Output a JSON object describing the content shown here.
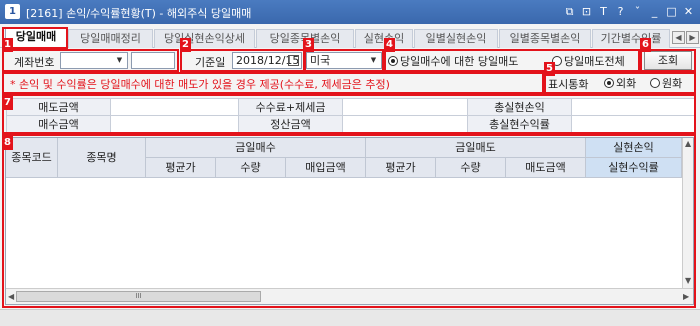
{
  "window": {
    "icon_text": "1",
    "title": "[2161] 손익/수익률현황(T) - 해외주식 당일매매",
    "buttons": [
      "⧉",
      "⊡",
      "T",
      "?",
      "ˇ",
      "_",
      "□",
      "✕"
    ]
  },
  "tabs": [
    "당일매매",
    "당일매매정리",
    "당일실현손익상세",
    "당일종목별손익",
    "실현손익",
    "일별실현손익",
    "일별종목별손익",
    "기간별수익률"
  ],
  "tab_nav": [
    "◀",
    "▶"
  ],
  "sections": [
    "1",
    "2",
    "3",
    "4",
    "5",
    "6",
    "7",
    "8"
  ],
  "form": {
    "account_label": "계좌번호",
    "account_value": "",
    "account_sub_value": "",
    "base_date_label": "기준일",
    "base_date_value": "2018/12/15",
    "market_value": "미국",
    "radio_today_buy": "당일매수에 대한 당일매도",
    "radio_all_sell": "당일매도전체",
    "query_button": "조회",
    "currency_label": "표시통화",
    "currency_foreign": "외화",
    "currency_won": "원화"
  },
  "notice": "* 손익 및 수익률은 당일매수에 대한 매도가 있을 경우 제공(수수료, 제세금은 추정)",
  "summary": {
    "sell_amount": "매도금액",
    "fee_tax": "수수료+제세금",
    "total_realized_pnl": "총실현손익",
    "buy_amount": "매수금액",
    "settle_amount": "정산금액",
    "total_realized_rate": "총실현수익률"
  },
  "grid": {
    "col_code": "종목코드",
    "col_name": "종목명",
    "grp_buy": "금일매수",
    "grp_sell": "금일매도",
    "grp_realized": "실현손익",
    "sub_avg": "평균가",
    "sub_qty": "수량",
    "sub_buy_amt": "매입금액",
    "sub_sell_amt": "매도금액",
    "sub_rate": "실현수익률",
    "scroll_thumb": "III"
  }
}
